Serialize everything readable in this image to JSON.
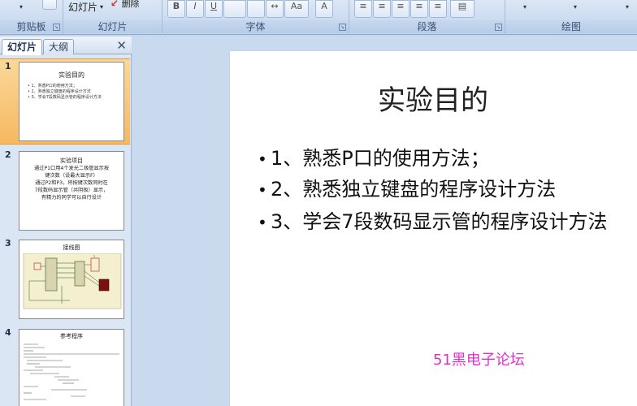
{
  "ribbon": {
    "slide_menu": {
      "label": "幻灯片",
      "arrow": "▾"
    },
    "delete_label": "删除",
    "groups": {
      "clipboard": "剪贴板",
      "slides": "幻灯片",
      "font": "字体",
      "paragraph": "段落",
      "drawing": "绘图"
    },
    "font_buttons": {
      "bold": "B",
      "italic": "I",
      "underline": "U",
      "text_size": "Aa",
      "clear_format": "A"
    },
    "launcher_glyph": "↘",
    "dropdown_arrow": "▾"
  },
  "pane": {
    "tabs": {
      "slides": "幻灯片",
      "outline": "大纲"
    },
    "close": "✕"
  },
  "thumbnails": [
    {
      "number": "1",
      "title": "实验目的",
      "lines": [
        "• 1、熟悉P口的使用方法；",
        "• 2、熟悉独立键盘的程序设计方法",
        "• 3、学会7段数码显示管的程序设计方法"
      ]
    },
    {
      "number": "2",
      "title": "实验项目",
      "lines": [
        "通过P1口用4个发光二极管显示按",
        "键次数（设最大显示F）",
        "通过P2和P3，将按键次数同时在",
        "7段数码显示管（共阴极）显示，",
        "有精力的同学可以自行设计"
      ]
    },
    {
      "number": "3",
      "title": "接线图"
    },
    {
      "number": "4",
      "title": "参考程序"
    }
  ],
  "slide": {
    "title": "实验目的",
    "bullet_glyph": "•",
    "bullets": [
      "1、熟悉P口的使用方法；",
      "2、熟悉独立键盘的程序设计方法",
      "3、学会7段数码显示管的程序设计方法"
    ],
    "footer_brand": "51黑电子论坛"
  },
  "colors": {
    "selected_thumb": "#f6b860",
    "brand_text": "#e030c8",
    "ribbon_bg": "#cddcf0"
  }
}
